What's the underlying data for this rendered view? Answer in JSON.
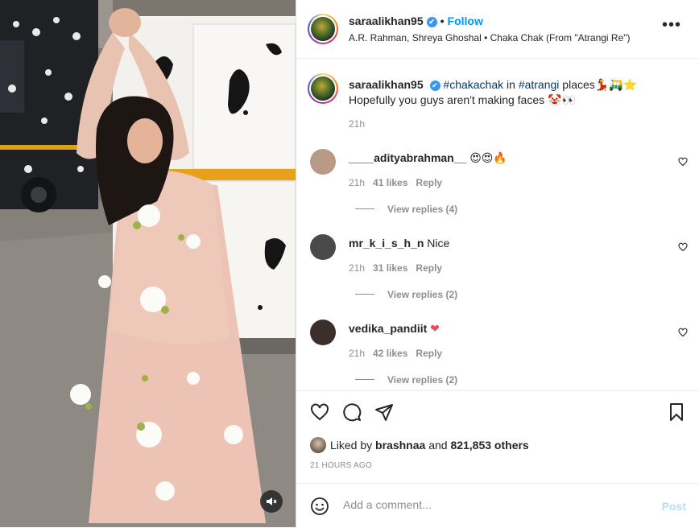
{
  "header": {
    "username": "saraalikhan95",
    "verified_mark": "✔",
    "separator": "•",
    "follow_label": "Follow",
    "audio": "A.R. Rahman, Shreya Ghoshal • Chaka Chak (From \"Atrangi Re\")",
    "more_icon": "more-horizontal-icon"
  },
  "caption": {
    "username": "saraalikhan95",
    "tag1": "#chakachak",
    "word_in": "in",
    "tag2": "#atrangi",
    "word_places": "places",
    "emojis_line1": "💃🛺⭐",
    "line2": "Hopefully you guys aren't making faces",
    "emojis_line2": "🤡👀",
    "time": "21h"
  },
  "comments": [
    {
      "username": "____adityabrahman__",
      "text": "😍😍🔥",
      "time": "21h",
      "likes": "41 likes",
      "reply": "Reply",
      "view_replies": "View replies (4)",
      "avatar_color": "#b89a86"
    },
    {
      "username": "mr_k_i_s_h_n",
      "text": "Nice",
      "time": "21h",
      "likes": "31 likes",
      "reply": "Reply",
      "view_replies": "View replies (2)",
      "avatar_color": "#4a4a4a"
    },
    {
      "username": "vedika_pandiit",
      "text": "❤",
      "time": "21h",
      "likes": "42 likes",
      "reply": "Reply",
      "view_replies": "View replies (2)",
      "avatar_color": "#3a2f2a"
    }
  ],
  "actions": {
    "like_icon": "heart-icon",
    "comment_icon": "comment-icon",
    "share_icon": "paper-plane-icon",
    "save_icon": "bookmark-icon"
  },
  "likes": {
    "prefix": "Liked by",
    "user": "brashnaa",
    "and": "and",
    "others": "821,853 others"
  },
  "time_ago": "21 HOURS AGO",
  "add_comment": {
    "placeholder": "Add a comment...",
    "post_label": "Post",
    "emoji_icon": "smiley-icon"
  },
  "media": {
    "mute_icon": "speaker-muted-icon"
  },
  "colors": {
    "accent": "#0095f6",
    "verified": "#3897f0",
    "tag": "#00376b",
    "muted_text": "#8e8e8e",
    "like_red": "#ed4956"
  }
}
